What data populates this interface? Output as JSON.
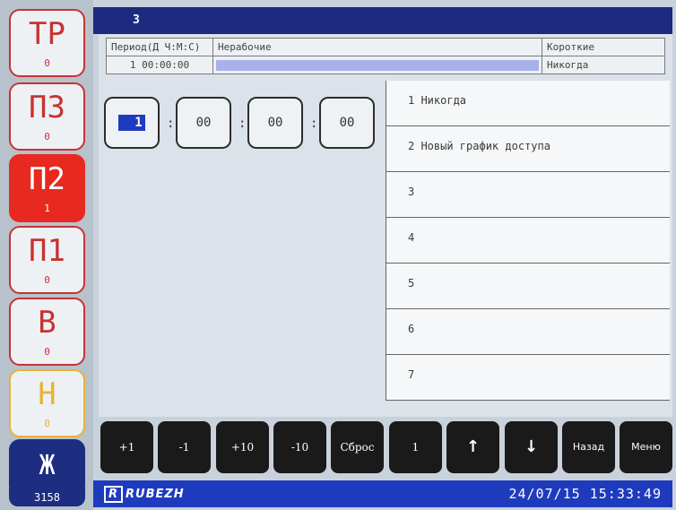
{
  "sidebar": {
    "categories": [
      {
        "code": "ТР",
        "count": "0"
      },
      {
        "code": "П3",
        "count": "0"
      },
      {
        "code": "П2",
        "count": "1"
      },
      {
        "code": "П1",
        "count": "0"
      },
      {
        "code": "В",
        "count": "0"
      },
      {
        "code": "Н",
        "count": "0"
      },
      {
        "code": "Ж"
      }
    ],
    "total": "3158"
  },
  "title": "3",
  "header": {
    "col1": "Период(Д Ч:М:С)",
    "col2": "Нерабочие",
    "col3": "Короткие",
    "period_value": "1 00:00:00",
    "short_value": "Никогда"
  },
  "time_editor": {
    "days": "1",
    "hours": "00",
    "minutes": "00",
    "seconds": "00",
    "sep": ":"
  },
  "list": [
    "1 Никогда",
    "2 Новый график доступа",
    "3",
    "4",
    "5",
    "6",
    "7"
  ],
  "buttons": {
    "plus1": "+1",
    "minus1": "-1",
    "plus10": "+10",
    "minus10": "-10",
    "reset": "Сброс",
    "one": "1",
    "up": "↑",
    "down": "↓",
    "back": "Назад",
    "menu": "Меню"
  },
  "footer": {
    "logo": "RUBEZH",
    "logo_mark": "R",
    "datetime": "24/07/15  15:33:49"
  },
  "colors": {
    "accent": "#1f3bbd",
    "alarm": "#e8291f",
    "warning": "#e8b33a",
    "dark": "#1c2a80"
  }
}
